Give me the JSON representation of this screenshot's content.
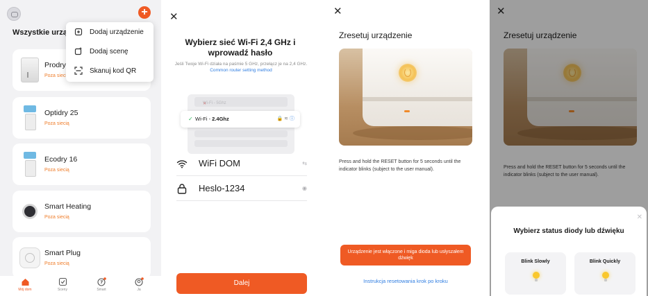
{
  "colors": {
    "accent": "#ef5a24",
    "status_orange": "#ef7d2a",
    "link_blue": "#2f7de1",
    "wifi_check_green": "#2fb65b"
  },
  "panel1": {
    "title": "Wszystkie urząd",
    "add_icon": "plus-icon",
    "menu": [
      {
        "label": "Dodaj urządzenie",
        "icon": "add-device-icon"
      },
      {
        "label": "Dodaj scenę",
        "icon": "add-scene-icon"
      },
      {
        "label": "Skanuj kod QR",
        "icon": "scan-qr-icon"
      }
    ],
    "devices": [
      {
        "name": "Prodry",
        "status": "Poza sieci"
      },
      {
        "name": "Optidry 25",
        "status": "Poza siecią"
      },
      {
        "name": "Ecodry 16",
        "status": "Poza siecią"
      },
      {
        "name": "Smart Heating",
        "status": "Poza siecią"
      },
      {
        "name": "Smart Plug",
        "status": "Poza siecią"
      }
    ],
    "tabs": [
      {
        "label": "Mój dom",
        "icon": "home-icon",
        "active": true
      },
      {
        "label": "Sceny",
        "icon": "scene-icon",
        "active": false
      },
      {
        "label": "Smart",
        "icon": "smart-icon",
        "active": false
      },
      {
        "label": "Ja",
        "icon": "profile-icon",
        "active": false
      }
    ]
  },
  "panel2": {
    "close": "✕",
    "title": "Wybierz sieć Wi-Fi 2,4 GHz i wprowadź hasło",
    "info": "Jeśli Twoje Wi-Fi działa na paśmie 5 GHz, przełącz je na 2,4 GHz.",
    "info_link": "Common router setting method",
    "illus_bad": "Wi-Fi - 5Ghz",
    "illus_good_prefix": "Wi-Fi -",
    "illus_good_bold": "2.4Ghz",
    "ssid": "WiFi DOM",
    "password": "Heslo-1234",
    "next_button": "Dalej"
  },
  "panel3": {
    "close": "✕",
    "title": "Zresetuj urządzenie",
    "instruction": "Press and hold the RESET button for 5 seconds until the indicator blinks (subject to the user manual).",
    "confirm_button": "Urządzenie jest włączone i miga dioda lub usłyszałem dźwięk",
    "help_link": "Instrukcja resetowania krok po kroku"
  },
  "panel4": {
    "close": "✕",
    "title": "Zresetuj urządzenie",
    "instruction": "Press and hold the RESET button for 5 seconds until the indicator blinks (subject to the user manual).",
    "sheet_close": "✕",
    "sheet_title": "Wybierz status diody lub dźwięku",
    "options": [
      {
        "label": "Blink Slowly"
      },
      {
        "label": "Blink Quickly"
      }
    ]
  }
}
